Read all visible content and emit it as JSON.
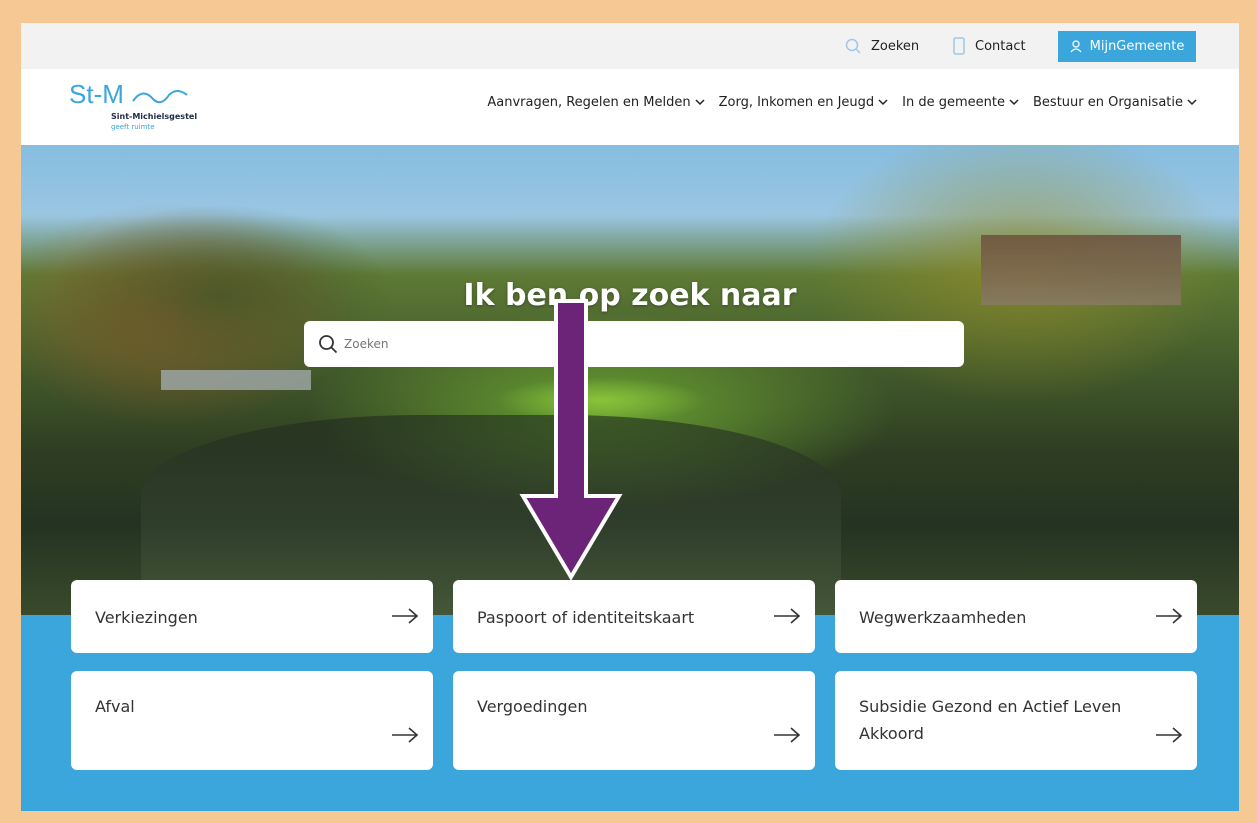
{
  "utility": {
    "search_label": "Zoeken",
    "contact_label": "Contact",
    "account_label": "MijnGemeente"
  },
  "logo": {
    "mark": "St-M",
    "name": "Sint-Michielsgestel",
    "tagline": "geeft ruimte"
  },
  "nav": {
    "items": [
      {
        "label": "Aanvragen, Regelen en Melden"
      },
      {
        "label": "Zorg, Inkomen en Jeugd"
      },
      {
        "label": "In de gemeente"
      },
      {
        "label": "Bestuur en Organisatie"
      }
    ]
  },
  "hero": {
    "title": "Ik ben op zoek naar",
    "search_placeholder": "Zoeken"
  },
  "cards": [
    {
      "label": "Verkiezingen"
    },
    {
      "label": "Paspoort of identiteitskaart"
    },
    {
      "label": "Wegwerkzaamheden"
    },
    {
      "label": "Afval"
    },
    {
      "label": "Vergoedingen"
    },
    {
      "label": "Subsidie Gezond en Actief Leven Akkoord"
    }
  ],
  "colors": {
    "accent": "#3aa6dc",
    "annotation_arrow": "#6b2477",
    "outer_border": "#f6c893"
  }
}
